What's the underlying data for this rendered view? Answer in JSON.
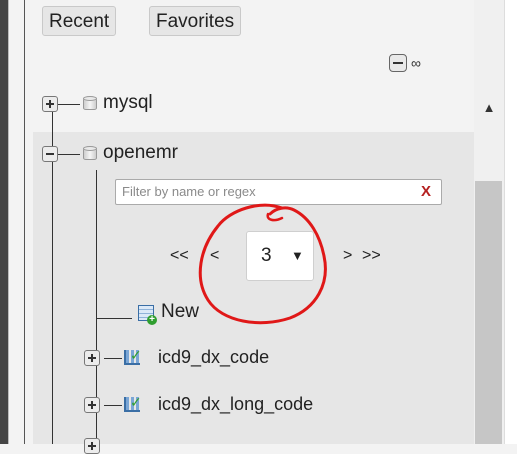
{
  "tabs": {
    "recent": "Recent",
    "favorites": "Favorites"
  },
  "toolbar": {
    "collapse_icon": "collapse-all-icon",
    "link_icon": "link-icon"
  },
  "tree": {
    "databases": [
      {
        "name": "mysql",
        "expanded": false
      },
      {
        "name": "openemr",
        "expanded": true
      }
    ],
    "filter": {
      "placeholder": "Filter by name or regex",
      "clear": "X"
    },
    "pager": {
      "first": "<<",
      "prev": "<",
      "page": "3",
      "next": ">",
      "last": ">>"
    },
    "items": [
      {
        "label": "New",
        "icon": "new-table-icon"
      },
      {
        "label": "icd9_dx_code",
        "icon": "table-icon"
      },
      {
        "label": "icd9_dx_long_code",
        "icon": "table-icon"
      }
    ]
  },
  "annotation": {
    "color": "#e01818"
  }
}
